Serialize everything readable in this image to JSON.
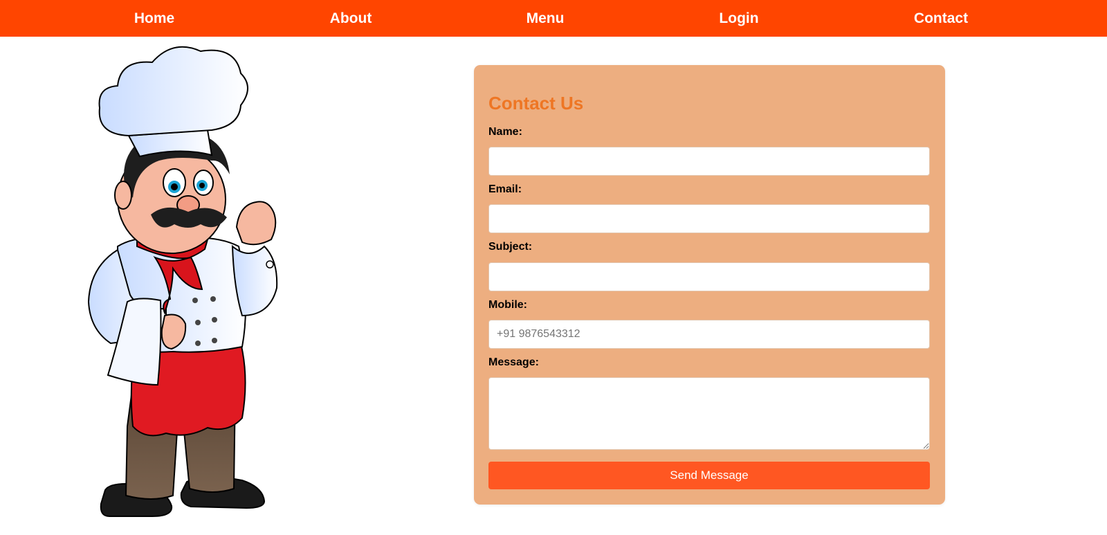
{
  "nav": {
    "items": [
      {
        "label": "Home"
      },
      {
        "label": "About"
      },
      {
        "label": "Menu"
      },
      {
        "label": "Login"
      },
      {
        "label": "Contact"
      }
    ]
  },
  "hero": {
    "image_icon": "chef-cartoon-illustration"
  },
  "contact_form": {
    "title": "Contact Us",
    "name_label": "Name:",
    "name_value": "",
    "email_label": "Email:",
    "email_value": "",
    "subject_label": "Subject:",
    "subject_value": "",
    "mobile_label": "Mobile:",
    "mobile_placeholder": "+91 9876543312",
    "message_label": "Message:",
    "message_value": "",
    "submit_label": "Send Message"
  },
  "colors": {
    "nav_background": "#ff4500",
    "panel_background": "#edae80",
    "title_color": "#ee7624",
    "button_background": "#ff5722"
  }
}
